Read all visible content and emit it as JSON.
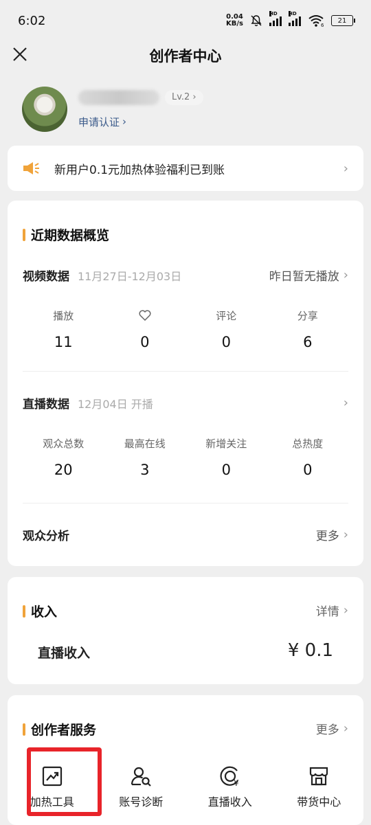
{
  "status": {
    "time": "6:02",
    "speed_value": "0.04",
    "speed_unit": "KB/s",
    "signal1_label": "HD",
    "signal2_label": "HD",
    "wifi_badge": "6",
    "battery": "21"
  },
  "nav": {
    "title": "创作者中心",
    "close_icon": "close-icon"
  },
  "profile": {
    "level": "Lv.2",
    "apply_label": "申请认证"
  },
  "notice": {
    "text": "新用户0.1元加热体验福利已到账"
  },
  "overview": {
    "title": "近期数据概览",
    "video": {
      "label": "视频数据",
      "date": "11月27日-12月03日",
      "right": "昨日暂无播放",
      "stats": [
        {
          "label": "播放",
          "value": "11"
        },
        {
          "label": "",
          "icon": "heart-icon",
          "value": "0"
        },
        {
          "label": "评论",
          "value": "0"
        },
        {
          "label": "分享",
          "value": "6"
        }
      ]
    },
    "live": {
      "label": "直播数据",
      "date": "12月04日 开播",
      "stats": [
        {
          "label": "观众总数",
          "value": "20"
        },
        {
          "label": "最高在线",
          "value": "3"
        },
        {
          "label": "新增关注",
          "value": "0"
        },
        {
          "label": "总热度",
          "value": "0"
        }
      ]
    },
    "audience": {
      "label": "观众分析",
      "more": "更多"
    }
  },
  "income": {
    "title": "收入",
    "more": "详情",
    "label": "直播收入",
    "value": "¥ 0.1"
  },
  "services": {
    "title": "创作者服务",
    "more": "更多",
    "items": [
      {
        "label": "加热工具",
        "icon": "trend-chart-icon"
      },
      {
        "label": "账号诊断",
        "icon": "user-search-icon"
      },
      {
        "label": "直播收入",
        "icon": "yuan-circle-icon"
      },
      {
        "label": "带货中心",
        "icon": "store-icon"
      }
    ]
  },
  "colors": {
    "accent": "#f0a33a",
    "highlight": "#e8242a",
    "link": "#3a5a8a"
  }
}
